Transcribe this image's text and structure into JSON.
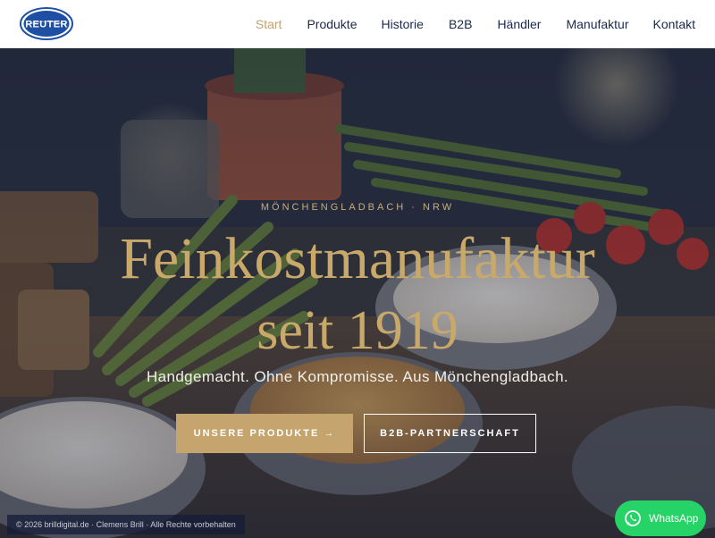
{
  "logo": {
    "text": "REUTER"
  },
  "nav": {
    "items": [
      {
        "label": "Start",
        "active": true
      },
      {
        "label": "Produkte",
        "active": false
      },
      {
        "label": "Historie",
        "active": false
      },
      {
        "label": "B2B",
        "active": false
      },
      {
        "label": "Händler",
        "active": false
      },
      {
        "label": "Manufaktur",
        "active": false
      },
      {
        "label": "Kontakt",
        "active": false
      }
    ]
  },
  "hero": {
    "kicker": "MÖNCHENGLADBACH · NRW",
    "title_line1": "Feinkostmanufaktur",
    "title_line2": "seit 1919",
    "subtitle": "Handgemacht. Ohne Kompromisse. Aus Mönchengladbach.",
    "primary_button": "UNSERE PRODUKTE →",
    "secondary_button": "B2B-PARTNERSCHAFT"
  },
  "footer": {
    "copyright": "© 2026 brilldigital.de · Clemens Brill · Alle Rechte vorbehalten"
  },
  "whatsapp": {
    "label": "WhatsApp",
    "icon": "whatsapp-icon"
  },
  "colors": {
    "accent": "#c5a46d",
    "nav": "#1b2a4a",
    "whatsapp": "#25d366"
  }
}
